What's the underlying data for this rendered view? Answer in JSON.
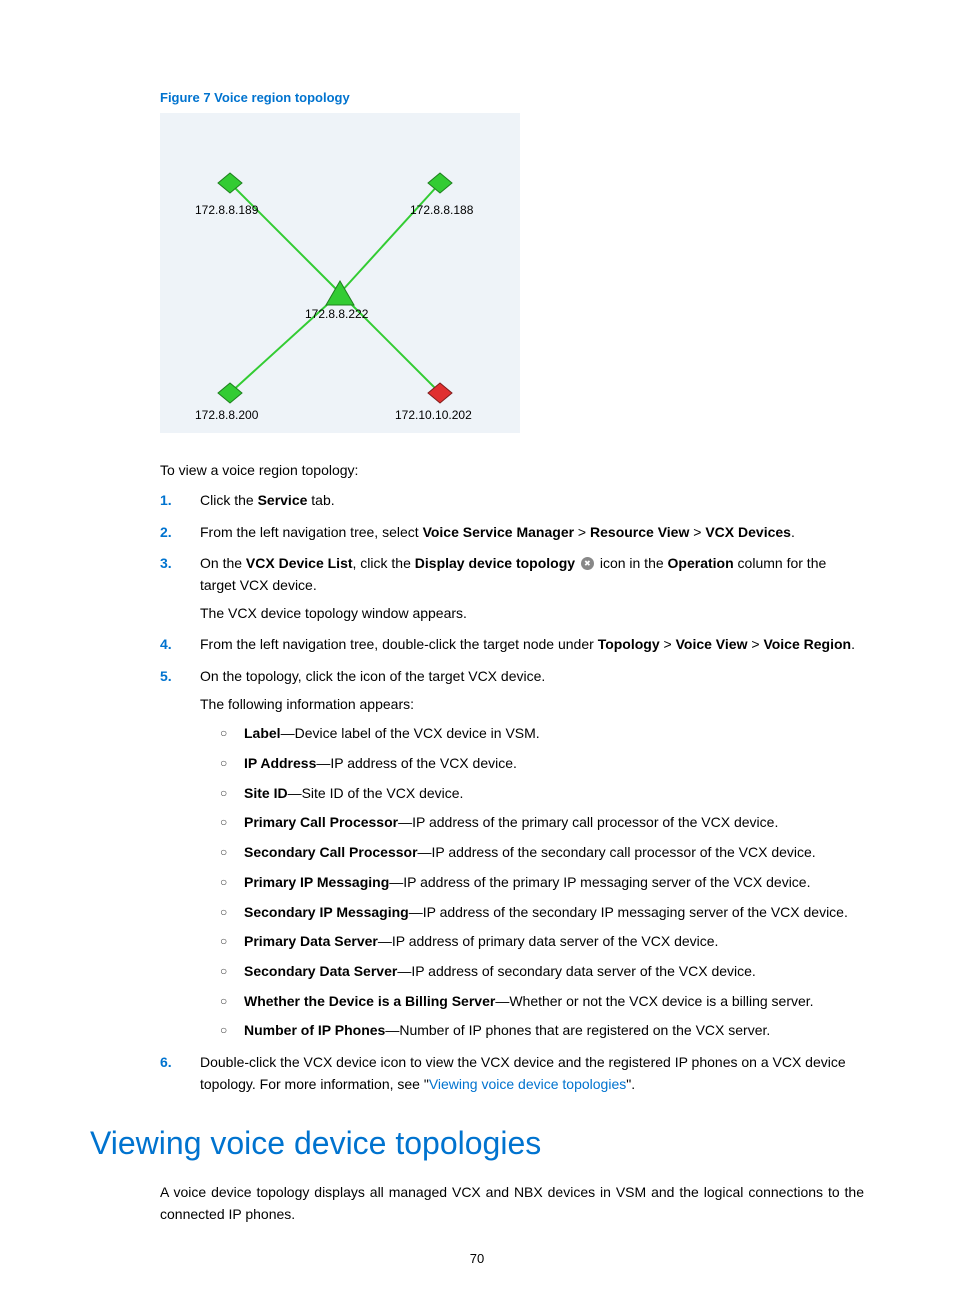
{
  "figureCaption": "Figure 7 Voice region topology",
  "topology": {
    "nodes": {
      "n189": "172.8.8.189",
      "n188": "172.8.8.188",
      "n222": "172.8.8.222",
      "n200": "172.8.8.200",
      "n202": "172.10.10.202"
    }
  },
  "introText": "To view a voice region topology:",
  "steps": {
    "s1": {
      "num": "1.",
      "a": "Click the ",
      "b": "Service",
      "c": " tab."
    },
    "s2": {
      "num": "2.",
      "a": "From the left navigation tree, select ",
      "b": "Voice Service Manager",
      "gt1": " > ",
      "c": "Resource View",
      "gt2": " > ",
      "d": "VCX Devices",
      "e": "."
    },
    "s3": {
      "num": "3.",
      "a": "On the ",
      "b": "VCX Device List",
      "c": ", click the ",
      "d": "Display device topology",
      "e": " ",
      "f": " icon in the ",
      "g": "Operation",
      "h": " column for the target VCX device.",
      "sub": "The VCX device topology window appears."
    },
    "s4": {
      "num": "4.",
      "a": "From the left navigation tree, double-click the target node under ",
      "b": "Topology",
      "gt1": " > ",
      "c": "Voice View",
      "gt2": " > ",
      "d": "Voice Region",
      "e": "."
    },
    "s5": {
      "num": "5.",
      "a": "On the topology, click the icon of the target VCX device.",
      "sub": "The following information appears:",
      "items": [
        {
          "t": "Label",
          "d": "—Device label of the VCX device in VSM."
        },
        {
          "t": "IP Address",
          "d": "—IP address of the VCX device."
        },
        {
          "t": "Site ID",
          "d": "—Site ID of the VCX device."
        },
        {
          "t": "Primary Call Processor",
          "d": "—IP address of the primary call processor of the VCX device."
        },
        {
          "t": "Secondary Call Processor",
          "d": "—IP address of the secondary call processor of the VCX device."
        },
        {
          "t": "Primary IP Messaging",
          "d": "—IP address of the primary IP messaging server of the VCX device."
        },
        {
          "t": "Secondary IP Messaging",
          "d": "—IP address of the secondary IP messaging server of the VCX device."
        },
        {
          "t": "Primary Data Server",
          "d": "—IP address of primary data server of the VCX device."
        },
        {
          "t": "Secondary Data Server",
          "d": "—IP address of secondary data server of the VCX device."
        },
        {
          "t": "Whether the Device is a Billing Server",
          "d": "—Whether or not the VCX device is a billing server."
        },
        {
          "t": "Number of IP Phones",
          "d": "—Number of IP phones that are registered on the VCX server."
        }
      ]
    },
    "s6": {
      "num": "6.",
      "a": "Double-click the VCX device icon to view the VCX device and the registered IP phones on a VCX device topology. For more information, see \"",
      "link": "Viewing voice device topologies",
      "b": "\"."
    }
  },
  "sectionTitle": "Viewing voice device topologies",
  "sectionPara": "A voice device topology displays all managed VCX and NBX devices in VSM and the logical connections to the connected IP phones.",
  "pageNumber": "70"
}
